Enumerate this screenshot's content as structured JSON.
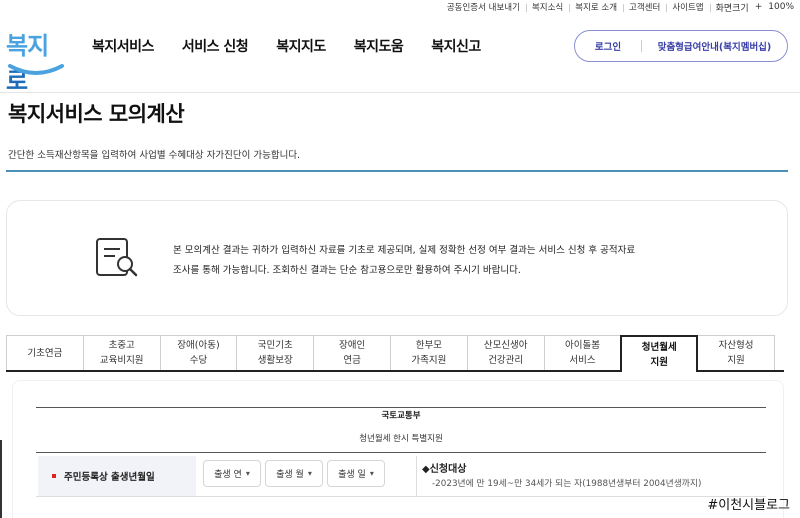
{
  "util_bar": {
    "items": [
      "공동인증서 내보내기",
      "복지소식",
      "복지로 소개",
      "고객센터",
      "사이트맵"
    ],
    "zoom_label": "화면크기",
    "zoom_plus": "+",
    "zoom_value": "100%"
  },
  "logo": {
    "text_a": "복지",
    "text_b": "로"
  },
  "gnb": [
    "복지서비스",
    "서비스 신청",
    "복지지도",
    "복지도움",
    "복지신고"
  ],
  "userbox": {
    "login": "로그인",
    "member": "맞춤형급여안내(복지멤버십)"
  },
  "page": {
    "title": "복지서비스 모의계산",
    "description": "간단한 소득재산항목을 입력하여 사업별 수혜대상 자가진단이 가능합니다."
  },
  "notice": {
    "line1": "본 모의계산 결과는 귀하가 입력하신 자료를 기초로 제공되며, 실제 정확한 선정 여부 결과는 서비스 신청 후 공적자료",
    "line2": "조사를 통해 가능합니다. 조회하신 결과는 단순 참고용으로만 활용하여 주시기 바랍니다."
  },
  "tabs": [
    {
      "l1": "기초연금",
      "l2": ""
    },
    {
      "l1": "초중고",
      "l2": "교육비지원"
    },
    {
      "l1": "장애(아동)",
      "l2": "수당"
    },
    {
      "l1": "국민기초",
      "l2": "생활보장"
    },
    {
      "l1": "장애인",
      "l2": "연금"
    },
    {
      "l1": "한부모",
      "l2": "가족지원"
    },
    {
      "l1": "산모신생아",
      "l2": "건강관리"
    },
    {
      "l1": "아이돌봄",
      "l2": "서비스"
    },
    {
      "l1": "청년월세",
      "l2": "지원"
    },
    {
      "l1": "자산형성",
      "l2": "지원"
    }
  ],
  "active_tab_index": 8,
  "content": {
    "agency": "국토교통부",
    "program": "청년월세 한시 특별지원",
    "field_label": "주민등록상 출생년월일",
    "select_year": "출생 연",
    "select_month": "출생 월",
    "select_day": "출생 일",
    "eligibility_title": "◆신청대상",
    "eligibility_text": "-2023년에 만 19세~만 34세가 되는 자(1988년생부터 2004년생까지)"
  },
  "watermark": "#이천시블로그",
  "colors": {
    "accent": "#4a90b8",
    "brand_blue": "#1e6bb8",
    "login_border": "#8a8fd6",
    "required_dot": "#dd2222"
  }
}
